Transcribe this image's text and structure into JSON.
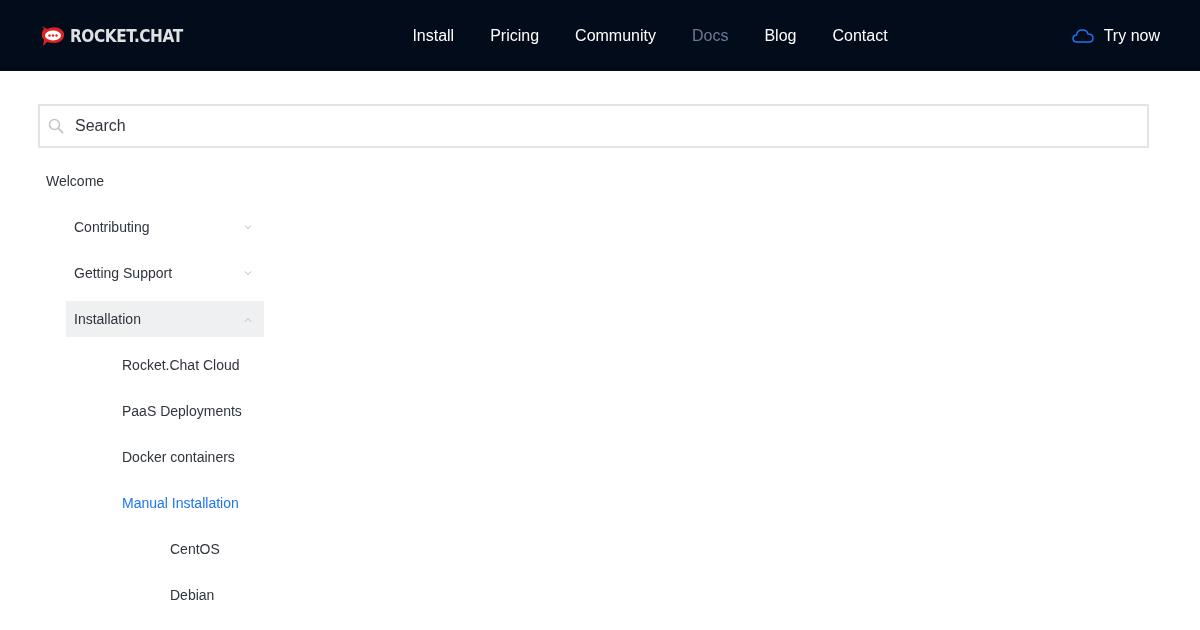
{
  "header": {
    "logo": "ROCKET.CHAT",
    "nav": [
      {
        "label": "Install",
        "selected": false
      },
      {
        "label": "Pricing",
        "selected": false
      },
      {
        "label": "Community",
        "selected": false
      },
      {
        "label": "Docs",
        "selected": true
      },
      {
        "label": "Blog",
        "selected": false
      },
      {
        "label": "Contact",
        "selected": false
      }
    ],
    "cta": "Try now"
  },
  "search": {
    "placeholder": "Search"
  },
  "sidebar": {
    "items": [
      {
        "label": "Welcome",
        "selected": false,
        "children": [
          {
            "label": "Contributing",
            "selected": false,
            "expanded": false
          },
          {
            "label": "Getting Support",
            "selected": false,
            "expanded": false
          },
          {
            "label": "Installation",
            "selected": false,
            "expanded": true,
            "children": [
              {
                "label": "Rocket.Chat Cloud",
                "selected": false
              },
              {
                "label": "PaaS Deployments",
                "selected": false
              },
              {
                "label": "Docker containers",
                "selected": false
              },
              {
                "label": "Manual Installation",
                "selected": true,
                "children": [
                  {
                    "label": "CentOS",
                    "selected": false
                  },
                  {
                    "label": "Debian",
                    "selected": false
                  }
                ]
              }
            ]
          }
        ]
      }
    ]
  }
}
